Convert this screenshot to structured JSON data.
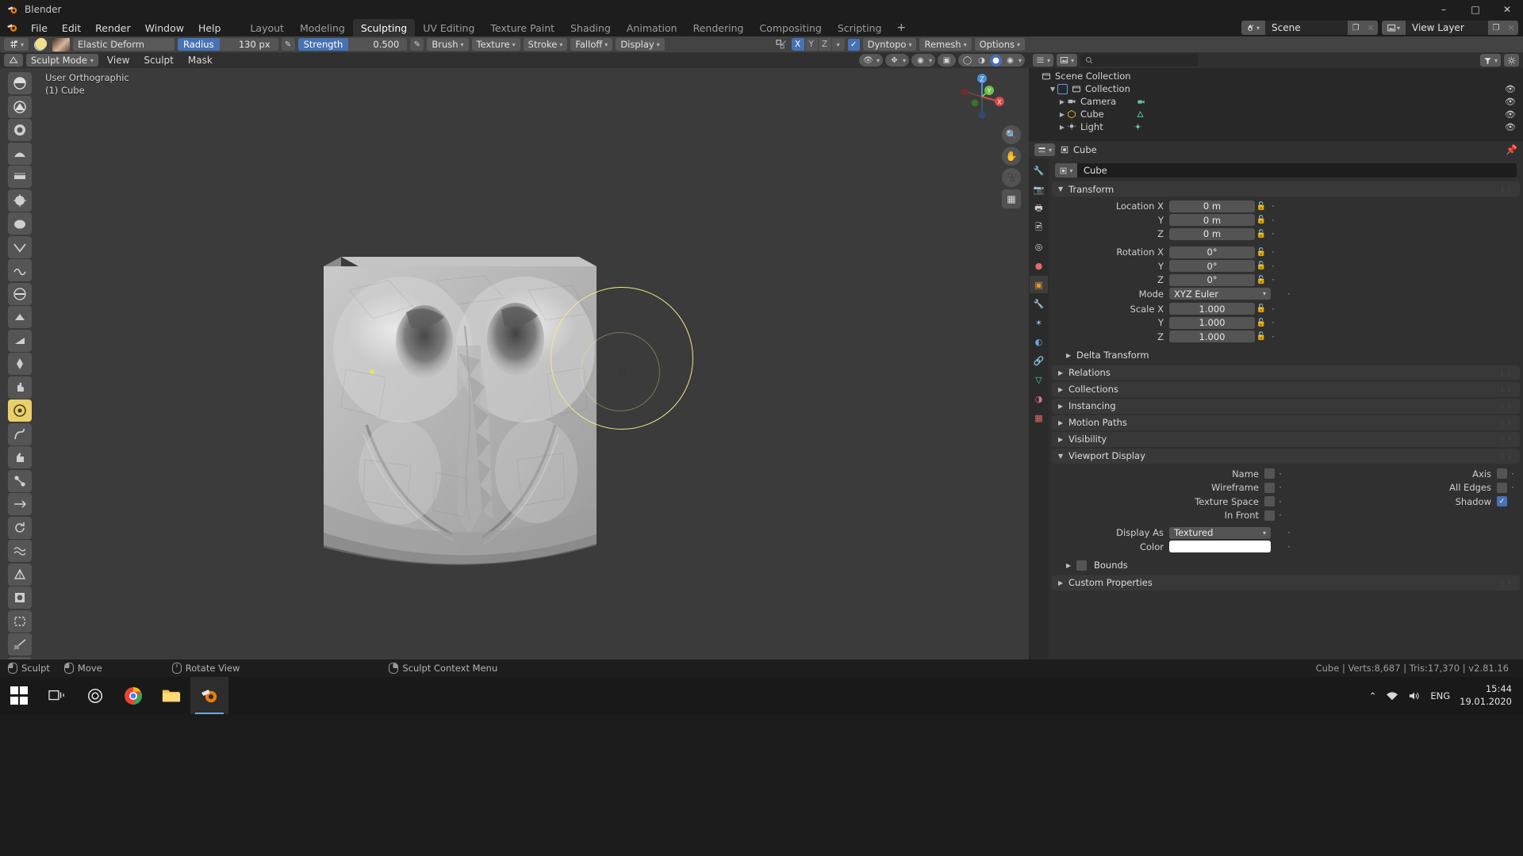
{
  "window": {
    "title": "Blender",
    "min_label": "–",
    "max_label": "□",
    "close_label": "✕"
  },
  "topbar": {
    "menus": [
      "File",
      "Edit",
      "Render",
      "Window",
      "Help"
    ],
    "workspaces": [
      {
        "label": "Layout",
        "active": false
      },
      {
        "label": "Modeling",
        "active": false
      },
      {
        "label": "Sculpting",
        "active": true
      },
      {
        "label": "UV Editing",
        "active": false
      },
      {
        "label": "Texture Paint",
        "active": false
      },
      {
        "label": "Shading",
        "active": false
      },
      {
        "label": "Animation",
        "active": false
      },
      {
        "label": "Rendering",
        "active": false
      },
      {
        "label": "Compositing",
        "active": false
      },
      {
        "label": "Scripting",
        "active": false
      }
    ],
    "add_workspace": "+",
    "scene": {
      "name": "Scene",
      "copy": "❐",
      "remove": "✕"
    },
    "view_layer": {
      "name": "View Layer",
      "copy": "❐",
      "remove": "✕"
    }
  },
  "toolheader": {
    "brush_name": "Elastic Deform",
    "radius_label": "Radius",
    "radius_value": "130 px",
    "strength_label": "Strength",
    "strength_value": "0.500",
    "menus": [
      "Brush",
      "Texture",
      "Stroke",
      "Falloff",
      "Display"
    ],
    "symmetry_axes": [
      {
        "label": "X",
        "on": true
      },
      {
        "label": "Y",
        "on": false
      },
      {
        "label": "Z",
        "on": false
      }
    ],
    "dyntopo_label": "Dyntopo",
    "dyntopo_checked": true,
    "remesh_label": "Remesh",
    "options_label": "Options"
  },
  "viewport_header": {
    "mode": "Sculpt Mode",
    "menus": [
      "View",
      "Sculpt",
      "Mask"
    ]
  },
  "viewport": {
    "view_name": "User Orthographic",
    "object_info": "(1) Cube",
    "gizmo_axes": [
      "X",
      "Y",
      "Z"
    ],
    "nav_buttons": [
      "zoom-icon",
      "hand-icon",
      "camera-icon",
      "grid-icon"
    ],
    "brush_radius_px": 130
  },
  "toolbar": {
    "tools": [
      {
        "name": "draw",
        "glyph": "◖",
        "active": false
      },
      {
        "name": "draw-sharp",
        "glyph": "◗",
        "active": false
      },
      {
        "name": "clay",
        "glyph": "◕",
        "active": false
      },
      {
        "name": "clay-strips",
        "glyph": "◢",
        "active": false
      },
      {
        "name": "layer",
        "glyph": "◤",
        "active": false
      },
      {
        "name": "inflate",
        "glyph": "●",
        "active": false
      },
      {
        "name": "blob",
        "glyph": "⬤",
        "active": false
      },
      {
        "name": "crease",
        "glyph": "▼",
        "active": false
      },
      {
        "name": "smooth",
        "glyph": "◔",
        "active": false
      },
      {
        "name": "flatten",
        "glyph": "▬",
        "active": false
      },
      {
        "name": "fill",
        "glyph": "▲",
        "active": false
      },
      {
        "name": "scrape",
        "glyph": "◥",
        "active": false
      },
      {
        "name": "pinch",
        "glyph": "◆",
        "active": false
      },
      {
        "name": "grab",
        "glyph": "✋",
        "active": false
      },
      {
        "name": "elastic-deform",
        "glyph": "○",
        "active": true
      },
      {
        "name": "snake-hook",
        "glyph": "⤳",
        "active": false
      },
      {
        "name": "thumb",
        "glyph": "☝",
        "active": false
      },
      {
        "name": "pose",
        "glyph": "⚔",
        "active": false
      },
      {
        "name": "nudge",
        "glyph": "↔",
        "active": false
      },
      {
        "name": "rotate",
        "glyph": "↻",
        "active": false
      },
      {
        "name": "slide-relax",
        "glyph": "≈",
        "active": false
      },
      {
        "name": "simplify",
        "glyph": "△",
        "active": false
      },
      {
        "name": "mask",
        "glyph": "■",
        "active": false
      },
      {
        "name": "box-mask",
        "glyph": "□",
        "active": false
      },
      {
        "name": "line-project",
        "glyph": "╱",
        "active": false
      },
      {
        "name": "mesh-filter",
        "glyph": "✷",
        "active": false
      }
    ]
  },
  "outliner": {
    "display_mode": "View Layer",
    "search_placeholder": "",
    "items": [
      {
        "label": "Scene Collection",
        "indent": 0,
        "icon": "collection-icon",
        "disclosure": "",
        "has_eye": false
      },
      {
        "label": "Collection",
        "indent": 1,
        "icon": "collection-icon",
        "disclosure": "▼",
        "has_eye": true
      },
      {
        "label": "Camera",
        "indent": 2,
        "icon": "camera-icon",
        "disclosure": "▶",
        "has_eye": true
      },
      {
        "label": "Cube",
        "indent": 2,
        "icon": "mesh-icon",
        "disclosure": "▶",
        "has_eye": true
      },
      {
        "label": "Light",
        "indent": 2,
        "icon": "light-icon",
        "disclosure": "▶",
        "has_eye": true
      }
    ]
  },
  "properties": {
    "breadcrumb_object": "Cube",
    "object_name_field": "Cube",
    "tabs": [
      {
        "name": "tool-tab",
        "glyph": "🔧",
        "color": "#d0d0d0",
        "active": false
      },
      {
        "name": "render-tab",
        "glyph": "📷",
        "color": "#d0d0d0",
        "active": false
      },
      {
        "name": "output-tab",
        "glyph": "🖼",
        "color": "#d0d0d0",
        "active": false
      },
      {
        "name": "view-layer-tab",
        "glyph": "🗂",
        "color": "#d0d0d0",
        "active": false
      },
      {
        "name": "scene-tab",
        "glyph": "◎",
        "color": "#d0d0d0",
        "active": false
      },
      {
        "name": "world-tab",
        "glyph": "●",
        "color": "#e06a6a",
        "active": false
      },
      {
        "name": "object-tab",
        "glyph": "▣",
        "color": "#e0913a",
        "active": true
      },
      {
        "name": "modifier-tab",
        "glyph": "🔧",
        "color": "#5d9ede",
        "active": false
      },
      {
        "name": "particles-tab",
        "glyph": "✦",
        "color": "#8ab4e8",
        "active": false
      },
      {
        "name": "physics-tab",
        "glyph": "◐",
        "color": "#6aa9e8",
        "active": false
      },
      {
        "name": "constraints-tab",
        "glyph": "🔗",
        "color": "#7fb3e8",
        "active": false
      },
      {
        "name": "data-tab",
        "glyph": "▽",
        "color": "#4ecb9c",
        "active": false
      },
      {
        "name": "material-tab",
        "glyph": "◑",
        "color": "#e06a8a",
        "active": false
      },
      {
        "name": "texture-tab",
        "glyph": "▦",
        "color": "#e06a6a",
        "active": false
      }
    ],
    "panels": {
      "transform": {
        "title": "Transform",
        "open": true,
        "rows": [
          {
            "label": "Location X",
            "value": "0 m"
          },
          {
            "label": "Y",
            "value": "0 m"
          },
          {
            "label": "Z",
            "value": "0 m"
          },
          {
            "label": "Rotation X",
            "value": "0°"
          },
          {
            "label": "Y",
            "value": "0°"
          },
          {
            "label": "Z",
            "value": "0°"
          }
        ],
        "mode_label": "Mode",
        "mode_value": "XYZ Euler",
        "scale_rows": [
          {
            "label": "Scale X",
            "value": "1.000"
          },
          {
            "label": "Y",
            "value": "1.000"
          },
          {
            "label": "Z",
            "value": "1.000"
          }
        ],
        "delta_transform": "Delta Transform"
      },
      "collapsed": [
        "Relations",
        "Collections",
        "Instancing",
        "Motion Paths",
        "Visibility"
      ],
      "viewport_display": {
        "title": "Viewport Display",
        "open": true,
        "toggles_left": [
          {
            "label": "Name",
            "checked": false
          },
          {
            "label": "Wireframe",
            "checked": false
          },
          {
            "label": "Texture Space",
            "checked": false
          },
          {
            "label": "In Front",
            "checked": false
          }
        ],
        "toggles_right": [
          {
            "label": "Axis",
            "checked": false
          },
          {
            "label": "All Edges",
            "checked": false
          },
          {
            "label": "Shadow",
            "checked": true
          }
        ],
        "display_as_label": "Display As",
        "display_as_value": "Textured",
        "color_label": "Color",
        "color_value": "#ffffff"
      },
      "bounds": {
        "label": "Bounds",
        "checked": false
      },
      "custom_properties": "Custom Properties"
    }
  },
  "statusbar": {
    "items": [
      {
        "icon": "mouse-left-icon",
        "label": "Sculpt"
      },
      {
        "icon": "mouse-left-icon",
        "label": "Move"
      },
      {
        "icon": "mouse-middle-icon",
        "label": "Rotate View"
      },
      {
        "icon": "mouse-right-icon",
        "label": "Sculpt Context Menu"
      }
    ],
    "scene_stats": "Cube | Verts:8,687 | Tris:17,370 | v2.81.16"
  },
  "taskbar": {
    "apps": [
      {
        "name": "start-button",
        "icon": "windows-logo"
      },
      {
        "name": "task-view-button",
        "icon": "task-view-icon"
      },
      {
        "name": "cortana-button",
        "icon": "cortana-icon"
      },
      {
        "name": "chrome-button",
        "icon": "chrome-icon"
      },
      {
        "name": "explorer-button",
        "icon": "folder-icon"
      },
      {
        "name": "blender-taskbar-button",
        "icon": "blender-icon",
        "active": true
      }
    ],
    "tray": {
      "chevron": "⌃",
      "lang": "ENG",
      "time": "15:44",
      "date": "19.01.2020"
    }
  }
}
